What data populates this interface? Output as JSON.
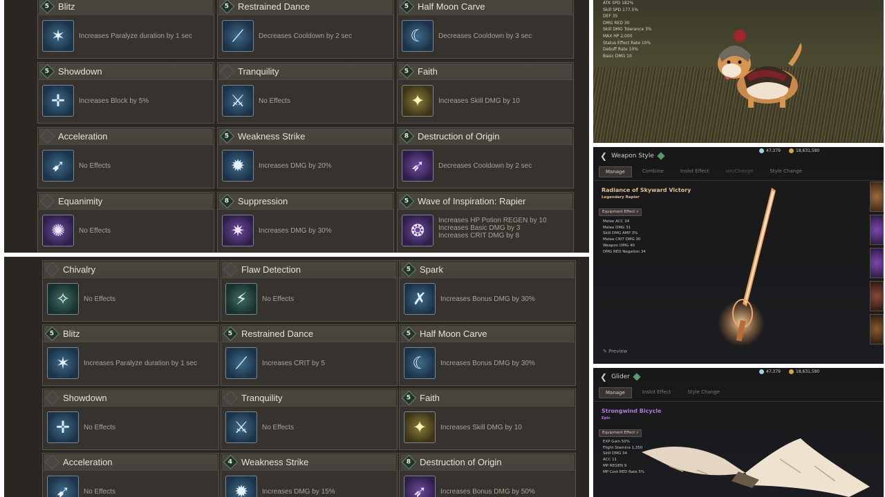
{
  "top_panel": {
    "cards": [
      {
        "name": "Blitz",
        "level": "5",
        "effect": [
          "Increases Paralyze duration by 1 sec"
        ],
        "icon": "blitz-icon",
        "icon_style": "blue",
        "glyph": "✶"
      },
      {
        "name": "Restrained Dance",
        "level": "5",
        "effect": [
          "Decreases Cooldown by 2 sec"
        ],
        "icon": "restrained-dance-icon",
        "icon_style": "blue",
        "glyph": "⟋"
      },
      {
        "name": "Half Moon Carve",
        "level": "5",
        "effect": [
          "Decreases Cooldown by 3 sec"
        ],
        "icon": "half-moon-carve-icon",
        "icon_style": "blue",
        "glyph": "☾"
      },
      {
        "name": "Showdown",
        "level": "5",
        "effect": [
          "Increases Block by 5%"
        ],
        "icon": "showdown-icon",
        "icon_style": "blue",
        "glyph": "✛"
      },
      {
        "name": "Tranquility",
        "level": "",
        "effect": [
          "No Effects"
        ],
        "icon": "tranquility-icon",
        "icon_style": "blue",
        "glyph": "⚔"
      },
      {
        "name": "Faith",
        "level": "5",
        "effect": [
          "Increases Skill DMG by 10"
        ],
        "icon": "faith-icon",
        "icon_style": "gold",
        "glyph": "✦"
      },
      {
        "name": "Acceleration",
        "level": "",
        "effect": [
          "No Effects"
        ],
        "icon": "acceleration-icon",
        "icon_style": "blue",
        "glyph": "➹"
      },
      {
        "name": "Weakness Strike",
        "level": "5",
        "effect": [
          "Increases DMG by 20%"
        ],
        "icon": "weakness-strike-icon",
        "icon_style": "blue",
        "glyph": "✹"
      },
      {
        "name": "Destruction of Origin",
        "level": "8",
        "effect": [
          "Decreases Cooldown by 2 sec"
        ],
        "icon": "destruction-of-origin-icon",
        "icon_style": "purple",
        "glyph": "➶"
      },
      {
        "name": "Equanimity",
        "level": "",
        "effect": [
          "No Effects"
        ],
        "icon": "equanimity-icon",
        "icon_style": "purple",
        "glyph": "✺"
      },
      {
        "name": "Suppression",
        "level": "8",
        "effect": [
          "Increases DMG by 30%"
        ],
        "icon": "suppression-icon",
        "icon_style": "purple",
        "glyph": "✷"
      },
      {
        "name": "Wave of Inspiration: Rapier",
        "level": "5",
        "effect": [
          "Increases HP Potion REGEN by 10",
          "Increases Basic DMG by 3",
          "Increases CRIT DMG by 8"
        ],
        "icon": "wave-of-inspiration-icon",
        "icon_style": "purple",
        "glyph": "❂"
      }
    ]
  },
  "bottom_panel": {
    "cards": [
      {
        "name": "Chivalry",
        "level": "",
        "effect": [
          "No Effects"
        ],
        "icon": "chivalry-icon",
        "icon_style": "teal",
        "glyph": "✧"
      },
      {
        "name": "Flaw Detection",
        "level": "",
        "effect": [
          "No Effects"
        ],
        "icon": "flaw-detection-icon",
        "icon_style": "teal",
        "glyph": "⚡"
      },
      {
        "name": "Spark",
        "level": "5",
        "effect": [
          "Increases Bonus DMG by 30%"
        ],
        "icon": "spark-icon",
        "icon_style": "blue",
        "glyph": "✗"
      },
      {
        "name": "Blitz",
        "level": "5",
        "effect": [
          "Increases Paralyze duration by 1 sec"
        ],
        "icon": "blitz-icon",
        "icon_style": "blue",
        "glyph": "✶"
      },
      {
        "name": "Restrained Dance",
        "level": "5",
        "effect": [
          "Increases CRIT by 5"
        ],
        "icon": "restrained-dance-icon",
        "icon_style": "blue",
        "glyph": "⟋"
      },
      {
        "name": "Half Moon Carve",
        "level": "5",
        "effect": [
          "Increases Bonus DMG by 30%"
        ],
        "icon": "half-moon-carve-icon",
        "icon_style": "blue",
        "glyph": "☾"
      },
      {
        "name": "Showdown",
        "level": "",
        "effect": [
          "No Effects"
        ],
        "icon": "showdown-icon",
        "icon_style": "blue",
        "glyph": "✛"
      },
      {
        "name": "Tranquility",
        "level": "",
        "effect": [
          "No Effects"
        ],
        "icon": "tranquility-icon",
        "icon_style": "blue",
        "glyph": "⚔"
      },
      {
        "name": "Faith",
        "level": "5",
        "effect": [
          "Increases Skill DMG by 10"
        ],
        "icon": "faith-icon",
        "icon_style": "gold",
        "glyph": "✦"
      },
      {
        "name": "Acceleration",
        "level": "",
        "effect": [
          "No Effects"
        ],
        "icon": "acceleration-icon",
        "icon_style": "blue",
        "glyph": "➹"
      },
      {
        "name": "Weakness Strike",
        "level": "4",
        "effect": [
          "Increases DMG by 15%"
        ],
        "icon": "weakness-strike-icon",
        "icon_style": "blue",
        "glyph": "✹"
      },
      {
        "name": "Destruction of Origin",
        "level": "8",
        "effect": [
          "Increases Bonus DMG by 50%"
        ],
        "icon": "destruction-of-origin-icon",
        "icon_style": "purple",
        "glyph": "➶"
      }
    ]
  },
  "pet_panel": {
    "stats": [
      "ATK SPD 182%",
      "Skill SPD 177.5%",
      "DEF 35",
      "DMG RED 30",
      "Skill DMG Tolerance 3%",
      "MAX HP 2,000",
      "Status Effect Rate 10%",
      "Debuff Rate 10%",
      "Basic DMG 10"
    ]
  },
  "weapon_panel": {
    "title": "Weapon Style",
    "currency_1": "47,379",
    "currency_2": "18,631,580",
    "tabs": [
      "Manage",
      "Combine",
      "Inslot Effect",
      "ion/Change",
      "Style Change"
    ],
    "item_name": "Radiance of Skyward Victory",
    "item_subtitle": "Legendary Rapier",
    "effect_button": "Equipment Effect",
    "stats": [
      "Melee ACC 34",
      "Melee DMG 31",
      "Skill DMG AMP 3%",
      "Melee CRIT DMG 30",
      "Weapon DMG 40",
      "DMG RED Negation 34"
    ],
    "preview_label": "Preview",
    "accent": "#e0c090"
  },
  "glider_panel": {
    "title": "Glider",
    "currency_1": "47,379",
    "currency_2": "18,631,580",
    "tabs": [
      "Manage",
      "Inslot Effect",
      "Style Change"
    ],
    "item_name": "Strongwind Bicycle",
    "item_subtitle": "Epic",
    "effect_button": "Equipment Effect",
    "stats": [
      "EXP Gain 50%",
      "Flight Stamina 1,350",
      "Skill DMG 34",
      "ACC 11",
      "MP REGEN 9",
      "MP Cost RED Rate 5%"
    ],
    "accent": "#b27ad8"
  }
}
